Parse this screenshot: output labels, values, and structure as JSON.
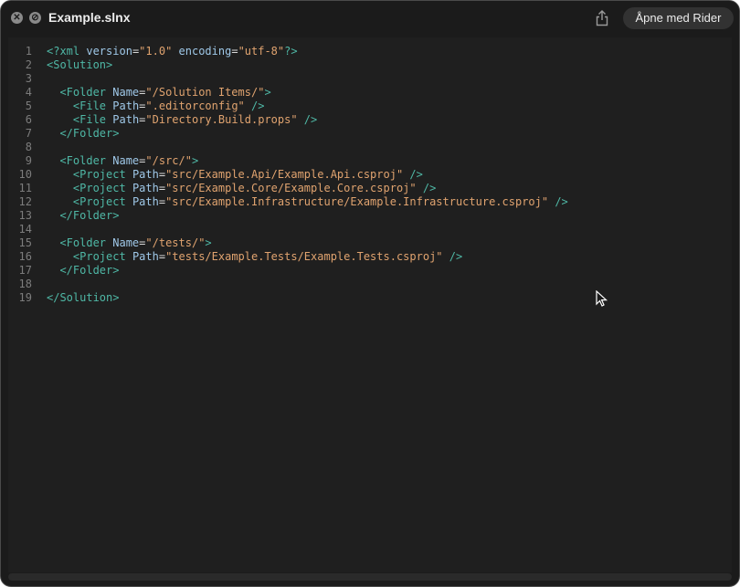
{
  "window": {
    "title": "Example.slnx",
    "open_button_label": "Åpne med Rider",
    "icons": {
      "close": "close-icon",
      "block": "block-icon",
      "share": "share-icon",
      "cursor": "mouse-pointer-icon"
    }
  },
  "code": {
    "lines": [
      {
        "n": "1",
        "tokens": [
          [
            "decl",
            "<?xml "
          ],
          [
            "attr",
            "version"
          ],
          [
            "eq",
            "="
          ],
          [
            "str",
            "\"1.0\""
          ],
          [
            "eq",
            " "
          ],
          [
            "attr",
            "encoding"
          ],
          [
            "eq",
            "="
          ],
          [
            "str",
            "\"utf-8\""
          ],
          [
            "decl",
            "?>"
          ]
        ]
      },
      {
        "n": "2",
        "tokens": [
          [
            "tag",
            "<Solution>"
          ]
        ]
      },
      {
        "n": "3",
        "tokens": []
      },
      {
        "n": "4",
        "tokens": [
          [
            "eq",
            "  "
          ],
          [
            "tag",
            "<Folder "
          ],
          [
            "attr",
            "Name"
          ],
          [
            "eq",
            "="
          ],
          [
            "str",
            "\"/Solution Items/\""
          ],
          [
            "tag",
            ">"
          ]
        ]
      },
      {
        "n": "5",
        "tokens": [
          [
            "eq",
            "    "
          ],
          [
            "tag",
            "<File "
          ],
          [
            "attr",
            "Path"
          ],
          [
            "eq",
            "="
          ],
          [
            "str",
            "\".editorconfig\""
          ],
          [
            "tag",
            " />"
          ]
        ]
      },
      {
        "n": "6",
        "tokens": [
          [
            "eq",
            "    "
          ],
          [
            "tag",
            "<File "
          ],
          [
            "attr",
            "Path"
          ],
          [
            "eq",
            "="
          ],
          [
            "str",
            "\"Directory.Build.props\""
          ],
          [
            "tag",
            " />"
          ]
        ]
      },
      {
        "n": "7",
        "tokens": [
          [
            "eq",
            "  "
          ],
          [
            "tag",
            "</Folder>"
          ]
        ]
      },
      {
        "n": "8",
        "tokens": []
      },
      {
        "n": "9",
        "tokens": [
          [
            "eq",
            "  "
          ],
          [
            "tag",
            "<Folder "
          ],
          [
            "attr",
            "Name"
          ],
          [
            "eq",
            "="
          ],
          [
            "str",
            "\"/src/\""
          ],
          [
            "tag",
            ">"
          ]
        ]
      },
      {
        "n": "10",
        "tokens": [
          [
            "eq",
            "    "
          ],
          [
            "tag",
            "<Project "
          ],
          [
            "attr",
            "Path"
          ],
          [
            "eq",
            "="
          ],
          [
            "str",
            "\"src/Example.Api/Example.Api.csproj\""
          ],
          [
            "tag",
            " />"
          ]
        ]
      },
      {
        "n": "11",
        "tokens": [
          [
            "eq",
            "    "
          ],
          [
            "tag",
            "<Project "
          ],
          [
            "attr",
            "Path"
          ],
          [
            "eq",
            "="
          ],
          [
            "str",
            "\"src/Example.Core/Example.Core.csproj\""
          ],
          [
            "tag",
            " />"
          ]
        ]
      },
      {
        "n": "12",
        "tokens": [
          [
            "eq",
            "    "
          ],
          [
            "tag",
            "<Project "
          ],
          [
            "attr",
            "Path"
          ],
          [
            "eq",
            "="
          ],
          [
            "str",
            "\"src/Example.Infrastructure/Example.Infrastructure.csproj\""
          ],
          [
            "tag",
            " />"
          ]
        ]
      },
      {
        "n": "13",
        "tokens": [
          [
            "eq",
            "  "
          ],
          [
            "tag",
            "</Folder>"
          ]
        ]
      },
      {
        "n": "14",
        "tokens": []
      },
      {
        "n": "15",
        "tokens": [
          [
            "eq",
            "  "
          ],
          [
            "tag",
            "<Folder "
          ],
          [
            "attr",
            "Name"
          ],
          [
            "eq",
            "="
          ],
          [
            "str",
            "\"/tests/\""
          ],
          [
            "tag",
            ">"
          ]
        ]
      },
      {
        "n": "16",
        "tokens": [
          [
            "eq",
            "    "
          ],
          [
            "tag",
            "<Project "
          ],
          [
            "attr",
            "Path"
          ],
          [
            "eq",
            "="
          ],
          [
            "str",
            "\"tests/Example.Tests/Example.Tests.csproj\""
          ],
          [
            "tag",
            " />"
          ]
        ]
      },
      {
        "n": "17",
        "tokens": [
          [
            "eq",
            "  "
          ],
          [
            "tag",
            "</Folder>"
          ]
        ]
      },
      {
        "n": "18",
        "tokens": []
      },
      {
        "n": "19",
        "tokens": [
          [
            "tag",
            "</Solution>"
          ]
        ]
      }
    ]
  },
  "colors": {
    "tag": "#4fb8a6",
    "attribute": "#9fc8e8",
    "string": "#e0a36f",
    "line_number": "#7c7c7c",
    "background": "#1f1f1f"
  }
}
